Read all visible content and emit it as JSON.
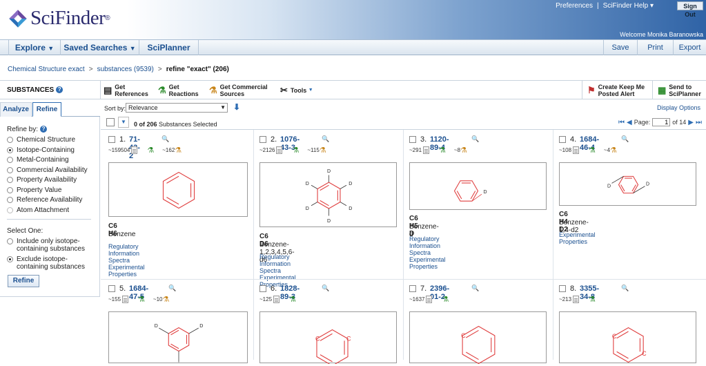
{
  "header": {
    "logo_text": "SciFinder",
    "logo_reg": "®",
    "preferences": "Preferences",
    "sep": "|",
    "help": "SciFinder Help ▾",
    "signout": "Sign Out",
    "welcome": "Welcome Monika Baranowska"
  },
  "nav": {
    "explore": "Explore",
    "saved_searches": "Saved Searches",
    "sciplanner": "SciPlanner",
    "save": "Save",
    "print": "Print",
    "export": "Export"
  },
  "breadcrumb": {
    "item1": "Chemical Structure exact",
    "item2": "substances (9539)",
    "current": "refine \"exact\" (206)",
    "sep": ">"
  },
  "toolbar": {
    "substances": "SUBSTANCES",
    "get_references_1": "Get",
    "get_references_2": "References",
    "get_reactions_1": "Get",
    "get_reactions_2": "Reactions",
    "get_commercial_1": "Get Commercial",
    "get_commercial_2": "Sources",
    "tools": "Tools",
    "keep_me_posted_1": "Create Keep Me",
    "keep_me_posted_2": "Posted Alert",
    "send_1": "Send to",
    "send_2": "SciPlanner"
  },
  "left": {
    "tab_analyze": "Analyze",
    "tab_refine": "Refine",
    "refine_by": "Refine by:",
    "options": [
      "Chemical Structure",
      "Isotope-Containing",
      "Metal-Containing",
      "Commercial Availability",
      "Property Availability",
      "Property Value",
      "Reference Availability",
      "Atom Attachment"
    ],
    "selected_option": "Isotope-Containing",
    "select_one": "Select One:",
    "include_1": "Include only isotope-",
    "include_2": "containing substances",
    "exclude_1": "Exclude isotope-",
    "exclude_2": "containing substances",
    "refine_button": "Refine"
  },
  "sort": {
    "label": "Sort by:",
    "value": "Relevance",
    "display_options": "Display Options"
  },
  "selection": {
    "count": "0 of 206",
    "suffix": "Substances Selected"
  },
  "pager": {
    "label": "Page:",
    "page": "1",
    "of": "of 14"
  },
  "results": [
    {
      "n": "1.",
      "cas": "71-43-2",
      "refs": "~159504",
      "reactions": "~162",
      "formula": "C6 H6",
      "name": "Benzene",
      "links": [
        "Regulatory Information",
        "Spectra",
        "Experimental Properties"
      ]
    },
    {
      "n": "2.",
      "cas": "1076-43-3",
      "refs": "~2126",
      "reactions": "~115",
      "formula": "C6 D6",
      "name": "Benzene-1,2,3,4,5,6-d6",
      "links": [
        "Regulatory Information",
        "Spectra",
        "Experimental Properties"
      ]
    },
    {
      "n": "3.",
      "cas": "1120-89-4",
      "refs": "~291",
      "reactions": "~8",
      "formula": "C6 H5 D",
      "name": "Benzene-d",
      "links": [
        "Regulatory Information",
        "Spectra",
        "Experimental Properties"
      ]
    },
    {
      "n": "4.",
      "cas": "1684-46-4",
      "refs": "~108",
      "reactions": "~4",
      "formula": "C6 H4 D2",
      "name": "Benzene-1,4-d2",
      "links": [
        "Experimental Properties"
      ]
    },
    {
      "n": "5.",
      "cas": "1684-47-5",
      "refs": "~155",
      "reactions": "~10",
      "formula": "",
      "name": "",
      "links": []
    },
    {
      "n": "6.",
      "cas": "1828-89-3",
      "refs": "~125",
      "reactions": "",
      "formula": "",
      "name": "",
      "links": []
    },
    {
      "n": "7.",
      "cas": "2396-01-2",
      "refs": "~1637",
      "reactions": "",
      "formula": "",
      "name": "",
      "links": []
    },
    {
      "n": "8.",
      "cas": "3355-34-8",
      "refs": "~213",
      "reactions": "",
      "formula": "",
      "name": "",
      "links": []
    }
  ],
  "atom_label": "D",
  "atom_label_c": "C",
  "colors": {
    "structure": "#e04040",
    "link": "#1a4f8f",
    "header_blue": "#2f63a6"
  }
}
